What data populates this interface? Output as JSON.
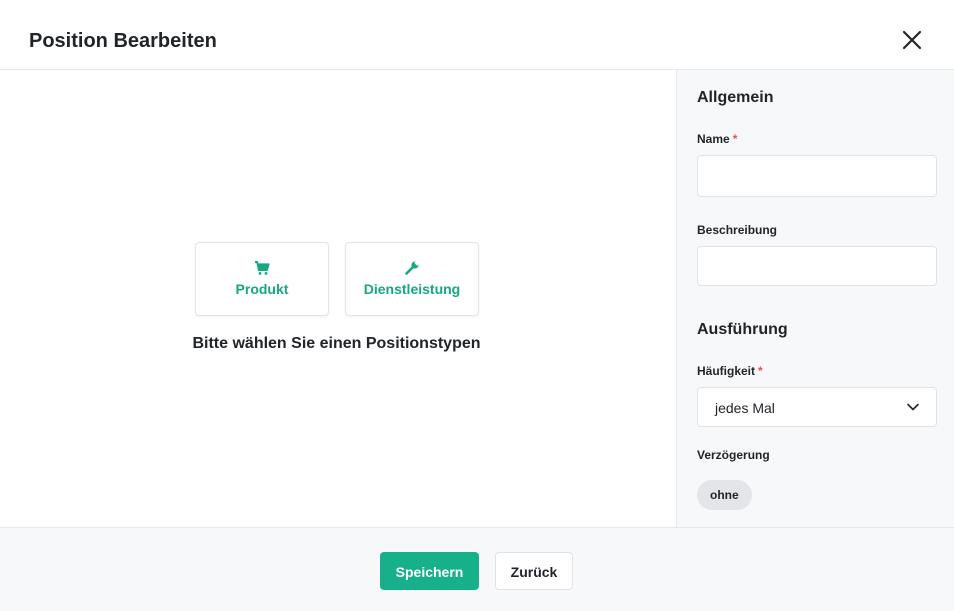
{
  "dialog": {
    "title": "Position Bearbeiten",
    "close_icon": "close-icon"
  },
  "type_selector": {
    "options": [
      {
        "label": "Produkt",
        "icon": "cart-icon"
      },
      {
        "label": "Dienstleistung",
        "icon": "wrench-icon"
      }
    ],
    "hint": "Bitte wählen Sie einen Positionstypen"
  },
  "sidebar": {
    "general": {
      "title": "Allgemein",
      "name_label": "Name",
      "name_value": "",
      "description_label": "Beschreibung",
      "description_value": "",
      "required_mark": "*"
    },
    "execution": {
      "title": "Ausführung",
      "frequency_label": "Häufigkeit",
      "frequency_value": "jedes Mal",
      "delay_label": "Verzögerung",
      "delay_value": "ohne"
    }
  },
  "footer": {
    "save_label": "Speichern",
    "back_label": "Zurück"
  },
  "colors": {
    "accent": "#16b08b",
    "accent_text": "#16a783",
    "required": "#e5533c"
  }
}
